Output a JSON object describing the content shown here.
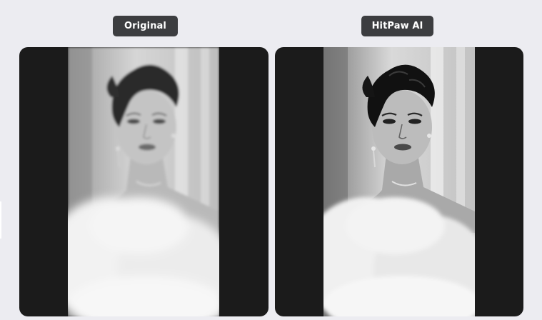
{
  "labels": {
    "original": "Original",
    "enhanced": "HitPaw AI"
  },
  "colors": {
    "page_background": "#ececf1",
    "label_background": "#3c3d40",
    "label_text": "#ffffff",
    "panel_background": "#1b1b1b"
  },
  "images": {
    "original": "black-and-white portrait of a woman with short curly hair and a feather boa (soft, blurred)",
    "enhanced": "same portrait sharpened with higher contrast"
  }
}
